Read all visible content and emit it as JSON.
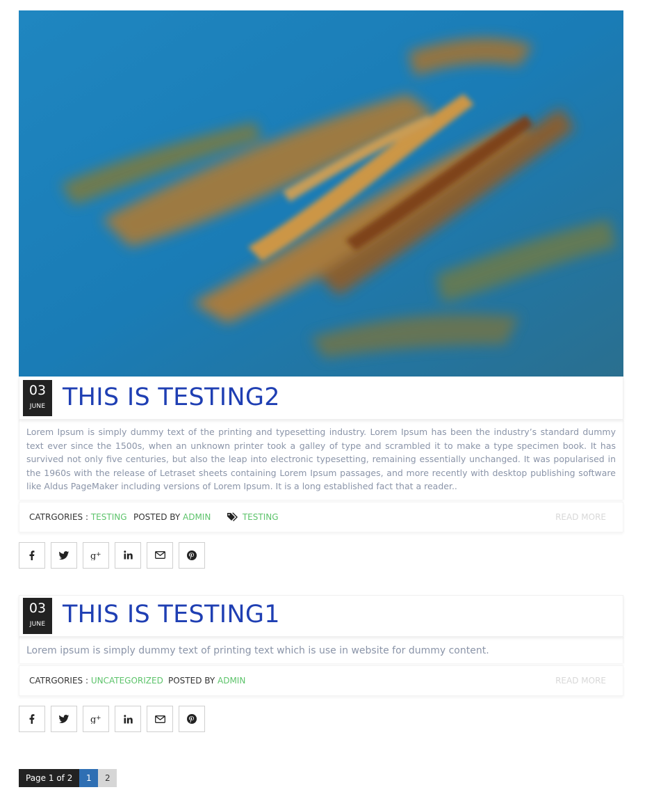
{
  "posts": [
    {
      "day": "03",
      "month": "JUNE",
      "title": "THIS IS TESTING2",
      "excerpt": "Lorem Ipsum is simply dummy text of the printing and typesetting industry. Lorem Ipsum has been the industry’s standard dummy text ever since the 1500s, when an unknown printer took a galley of type and scrambled it to make a type specimen book. It has survived not only five centuries, but also the leap into electronic typesetting, remaining essentially unchanged. It was popularised in the 1960s with the release of Letraset sheets containing Lorem Ipsum passages, and more recently with desktop publishing software like Aldus PageMaker including versions of Lorem Ipsum. It is a long established fact that a reader..",
      "categories_label": "CATRGORIES :",
      "category": "TESTING",
      "posted_by_label": "POSTED BY",
      "author": "ADMIN",
      "tag": "TESTING",
      "read_more": "READ MORE"
    },
    {
      "day": "03",
      "month": "JUNE",
      "title": "THIS IS TESTING1",
      "excerpt": "Lorem ipsum is simply dummy text of printing text which is use in website for dummy content.",
      "categories_label": "CATRGORIES :",
      "category": "UNCATEGORIZED",
      "posted_by_label": "POSTED BY",
      "author": "ADMIN",
      "read_more": "READ MORE"
    }
  ],
  "share_icons": [
    "facebook-icon",
    "twitter-icon",
    "google-plus-icon",
    "linkedin-icon",
    "email-icon",
    "pinterest-icon"
  ],
  "pagination": {
    "info": "Page 1 of 2",
    "current": "1",
    "next": "2"
  },
  "colors": {
    "title": "#1f3fb3",
    "link": "#5cc36a",
    "date_box": "#222222",
    "page_current": "#2f6fb3"
  }
}
